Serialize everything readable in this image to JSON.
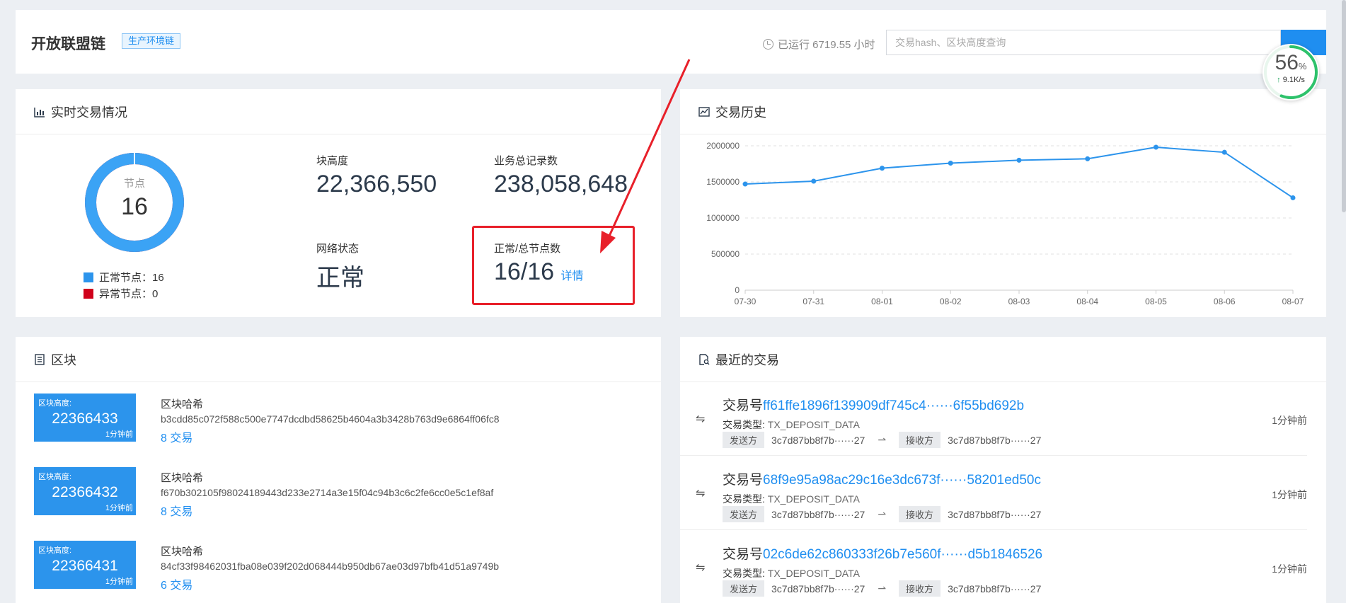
{
  "header": {
    "app_title": "开放联盟链",
    "env_badge": "生产环境链",
    "uptime": "已运行 6719.55 小时",
    "search_placeholder": "交易hash、区块高度查询",
    "speed_percent": "56",
    "speed_percent_unit": "%",
    "speed_rate": "9.1K/s"
  },
  "realtime": {
    "title": "实时交易情况",
    "donut_label": "节点",
    "donut_value": "16",
    "normal_fraction": 1.0,
    "legend": [
      {
        "label": "正常节点：16",
        "color": "#2c94ec"
      },
      {
        "label": "异常节点：0",
        "color": "#d0021b"
      }
    ],
    "block_height_label": "块高度",
    "block_height": "22,366,550",
    "total_records_label": "业务总记录数",
    "total_records": "238,058,648",
    "network_status_label": "网络状态",
    "network_status": "正常",
    "node_ratio_label": "正常/总节点数",
    "node_ratio": "16/16",
    "detail_link": "详情"
  },
  "history": {
    "title": "交易历史"
  },
  "chart_data": {
    "type": "line",
    "title": "",
    "xlabel": "",
    "ylabel": "",
    "x": [
      "07-30",
      "07-31",
      "08-01",
      "08-02",
      "08-03",
      "08-04",
      "08-05",
      "08-06",
      "08-07"
    ],
    "values": [
      1470000,
      1510000,
      1690000,
      1760000,
      1800000,
      1820000,
      1980000,
      1910000,
      1280000
    ],
    "yticks": [
      "0",
      "500000",
      "1000000",
      "1500000",
      "2000000"
    ],
    "ylim": [
      0,
      2000000
    ],
    "grid": true,
    "color": "#2c94ec"
  },
  "blocks": {
    "title": "区块",
    "height_label": "区块高度:",
    "hash_label": "区块哈希",
    "items": [
      {
        "height": "22366433",
        "time": "1分钟前",
        "hash": "b3cdd85c072f588c500e7747dcdbd58625b4604a3b3428b763d9e6864ff06fc8",
        "tx": "8 交易"
      },
      {
        "height": "22366432",
        "time": "1分钟前",
        "hash": "f670b302105f98024189443d233e2714a3e15f04c94b3c6c2fe6cc0e5c1ef8af",
        "tx": "8 交易"
      },
      {
        "height": "22366431",
        "time": "1分钟前",
        "hash": "84cf33f98462031fba08e039f202d068444b950db67ae03d97bfb41d51a9749b",
        "tx": "6 交易"
      }
    ]
  },
  "transactions": {
    "title": "最近的交易",
    "tx_prefix": "交易号",
    "type_label": "交易类型:",
    "sender_label": "发送方",
    "receiver_label": "接收方",
    "items": [
      {
        "hash": "ff61ffe1896f139909df745c4······6f55bd692b",
        "type": "TX_DEPOSIT_DATA",
        "sender": "3c7d87bb8f7b······27",
        "receiver": "3c7d87bb8f7b······27",
        "time": "1分钟前"
      },
      {
        "hash": "68f9e95a98ac29c16e3dc673f······58201ed50c",
        "type": "TX_DEPOSIT_DATA",
        "sender": "3c7d87bb8f7b······27",
        "receiver": "3c7d87bb8f7b······27",
        "time": "1分钟前"
      },
      {
        "hash": "02c6de62c860333f26b7e560f······d5b1846526",
        "type": "TX_DEPOSIT_DATA",
        "sender": "3c7d87bb8f7b······27",
        "receiver": "3c7d87bb8f7b······27",
        "time": "1分钟前"
      }
    ]
  }
}
